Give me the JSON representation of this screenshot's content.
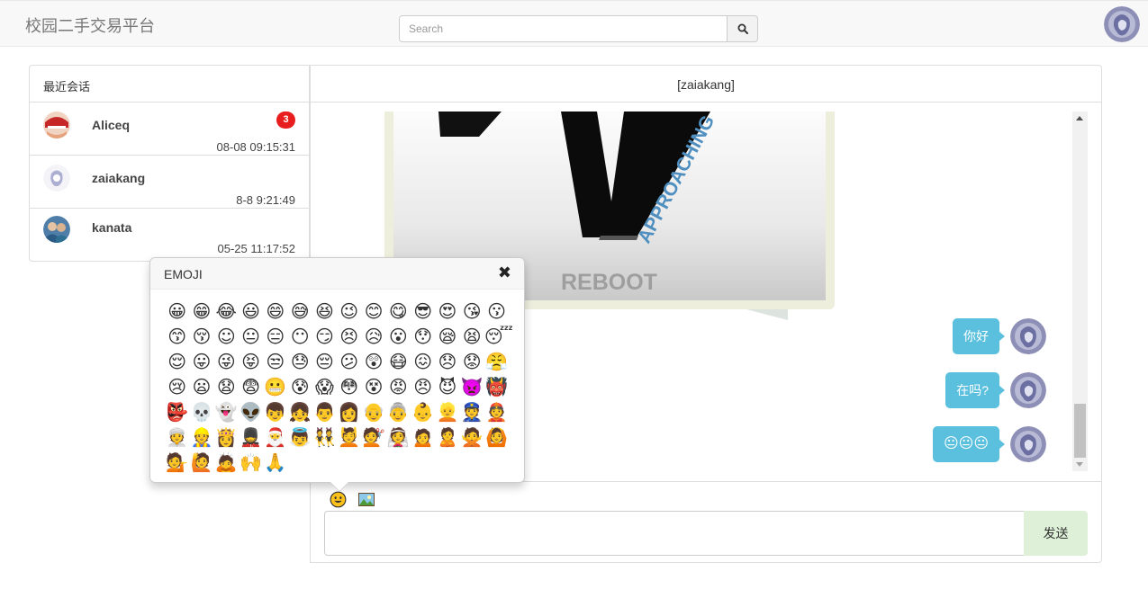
{
  "navbar": {
    "brand": "校园二手交易平台",
    "search_placeholder": "Search",
    "search_icon": "search-icon",
    "avatar_icon": "user-avatar"
  },
  "conversations": {
    "header": "最近会话",
    "items": [
      {
        "name": "Aliceq",
        "time": "08-08 09:15:31",
        "badge": "3"
      },
      {
        "name": "zaiakang",
        "time": "8-8 9:21:49",
        "badge": ""
      },
      {
        "name": "kanata",
        "time": "05-25 11:17:52",
        "badge": ""
      }
    ]
  },
  "chat": {
    "title": "[zaiakang]",
    "image_text": "REBOOT",
    "image_subtext": "APPROACHING",
    "messages": [
      {
        "text": "你好"
      },
      {
        "text": "在吗?"
      },
      {
        "text": "😐😐😐"
      }
    ],
    "send_label": "发送"
  },
  "emoji_popover": {
    "title": "EMOJI",
    "close_icon": "close-icon",
    "emojis": [
      "😀",
      "😁",
      "😂",
      "😃",
      "😄",
      "😅",
      "😆",
      "😉",
      "😊",
      "😋",
      "😎",
      "😍",
      "😘",
      "😗",
      "😙",
      "😚",
      "☺",
      "😐",
      "😑",
      "😶",
      "😏",
      "😣",
      "😥",
      "😮",
      "😯",
      "😪",
      "😫",
      "😴",
      "😌",
      "😛",
      "😜",
      "😝",
      "😒",
      "😓",
      "😔",
      "😕",
      "😲",
      "😷",
      "😖",
      "😞",
      "😟",
      "😤",
      "😢",
      "😦",
      "😧",
      "😨",
      "😬",
      "😰",
      "😱",
      "😳",
      "😵",
      "😡",
      "😠",
      "😈",
      "👿",
      "👹",
      "👺",
      "💀",
      "👻",
      "👽",
      "👦",
      "👧",
      "👨",
      "👩",
      "👴",
      "👵",
      "👶",
      "👱",
      "👮",
      "👲",
      "👳",
      "👷",
      "👸",
      "💂",
      "🎅",
      "👼",
      "👯",
      "💆",
      "💇",
      "👰",
      "🙍",
      "🙎",
      "🙅",
      "🙆",
      "💁",
      "🙋",
      "🙇",
      "🙌",
      "🙏"
    ],
    "colors": {
      "face": "#fcc21b",
      "accent": "#5bc0de",
      "send_bg": "#dff0d8",
      "badge": "#e81e1e"
    }
  }
}
